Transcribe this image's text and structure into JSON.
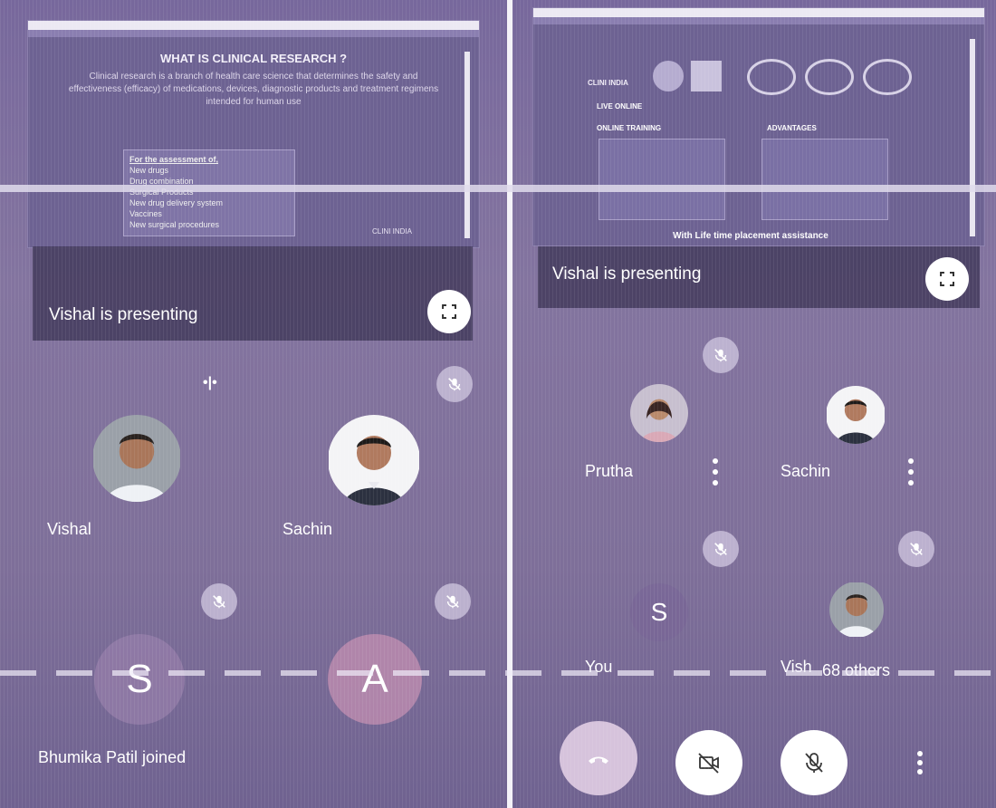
{
  "left": {
    "slide": {
      "title": "WHAT IS CLINICAL RESEARCH ?",
      "text": "Clinical research is a branch of health care science that determines the safety and effectiveness (efficacy) of medications, devices, diagnostic products and treatment regimens intended for human use",
      "box_title": "For the assessment of,",
      "box_items": [
        "New drugs",
        "Drug combination",
        "Surgical Products",
        "New drug delivery system",
        "Vaccines",
        "New surgical procedures"
      ],
      "logo": "CLINI INDIA"
    },
    "presenting_label": "Vishal is presenting",
    "speaking_indicator": "•|•",
    "participants": [
      {
        "name": "Vishal"
      },
      {
        "name": "Sachin"
      }
    ],
    "tiles": [
      {
        "initial": "S"
      },
      {
        "initial": "A"
      }
    ],
    "toast": "Bhumika Patil joined"
  },
  "right": {
    "slide": {
      "logo": "CLINI INDIA",
      "line1_label": "LIVE ONLINE",
      "line2_label": "ONLINE TRAINING",
      "line2_right": "ADVANTAGES",
      "footer": "With Life time placement assistance"
    },
    "presenting_label": "Vishal is presenting",
    "participants": [
      {
        "name": "Prutha"
      },
      {
        "name": "Sachin"
      },
      {
        "name": "You",
        "initial": "S"
      },
      {
        "name": "Vish"
      }
    ],
    "others_label": "68 others"
  },
  "colors": {
    "panel": "#7a6c9c",
    "end_call": "#cfb9d8",
    "white_btn": "#ffffff"
  },
  "icons": [
    "fullscreen-icon",
    "mic-off-icon",
    "video-off-icon",
    "end-call-icon",
    "more-vert-icon"
  ]
}
